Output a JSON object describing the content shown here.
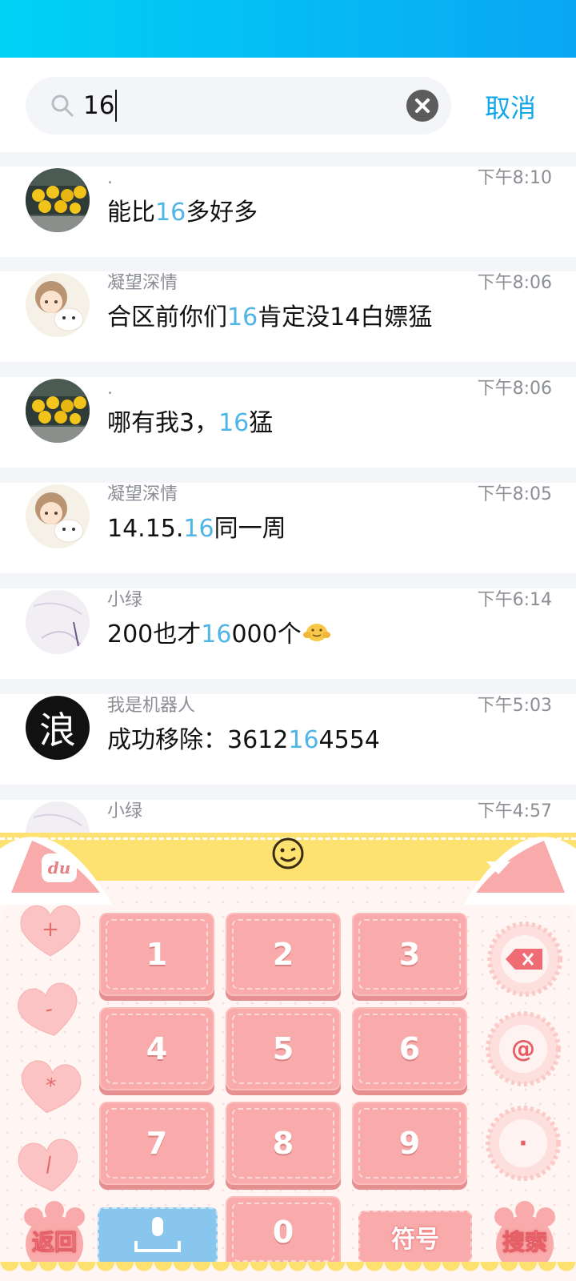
{
  "search": {
    "query": "16",
    "cancel_label": "取消"
  },
  "results": [
    {
      "sender": ".",
      "time": "下午8:10",
      "pre": "能比",
      "hl": "16",
      "post": "多好多",
      "avatar": "ducks"
    },
    {
      "sender": "凝望深情",
      "time": "下午8:06",
      "pre": "合区前你们",
      "hl": "16",
      "post": "肯定没14白嫖猛",
      "avatar": "cartoon"
    },
    {
      "sender": ".",
      "time": "下午8:06",
      "pre": "哪有我3，",
      "hl": "16",
      "post": "猛",
      "avatar": "ducks"
    },
    {
      "sender": "凝望深情",
      "time": "下午8:05",
      "pre": "14.15.",
      "hl": "16",
      "post": "同一周",
      "avatar": "cartoon"
    },
    {
      "sender": "小绿",
      "time": "下午6:14",
      "pre": "200也才",
      "hl": "16",
      "post": "000个",
      "avatar": "sketch"
    },
    {
      "sender": "我是机器人",
      "time": "下午5:03",
      "pre": "成功移除：3612",
      "hl": "16",
      "post": "4554",
      "avatar": "wave"
    },
    {
      "sender": "小绿",
      "time": "下午4:57",
      "pre": "",
      "hl": "",
      "post": "",
      "avatar": "sketch"
    }
  ],
  "robot_avatar_char": "浪",
  "keyboard": {
    "logo": "du",
    "digits": [
      "1",
      "2",
      "3",
      "4",
      "5",
      "6",
      "7",
      "8",
      "9",
      "0"
    ],
    "ops": [
      "+",
      "-",
      "*",
      "/"
    ],
    "at": "@",
    "dot": "·",
    "back_label": "返回",
    "symbol_label": "符号",
    "search_label": "搜索"
  },
  "colors": {
    "header_gradient_start": "#00d2f5",
    "header_gradient_end": "#0aa6f3",
    "highlight": "#4fb4e6",
    "cancel": "#12a7e6",
    "key_pink": "#f9aaaa",
    "keyboard_yellow": "#fde272"
  }
}
